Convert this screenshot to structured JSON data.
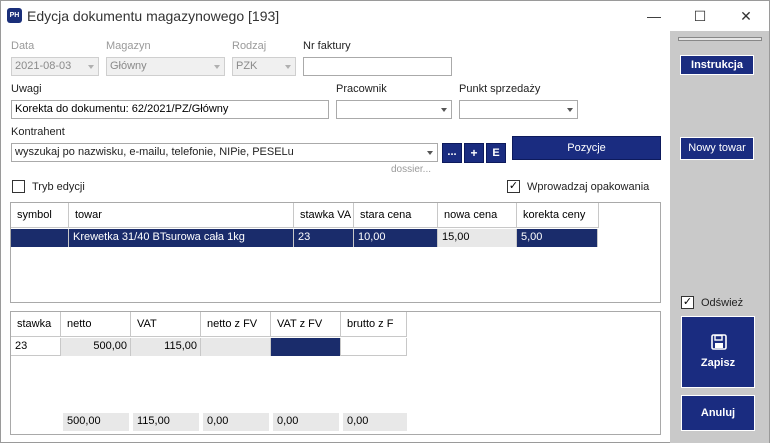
{
  "window": {
    "title": "Edycja dokumentu magazynowego [193]",
    "app_icon": "PH",
    "minimize": "—",
    "maximize": "☐",
    "close": "✕"
  },
  "form": {
    "data_label": "Data",
    "data_value": "2021-08-03",
    "magazyn_label": "Magazyn",
    "magazyn_value": "Główny",
    "rodzaj_label": "Rodzaj",
    "rodzaj_value": "PZK",
    "nr_faktury_label": "Nr faktury",
    "nr_faktury_value": "",
    "uwagi_label": "Uwagi",
    "uwagi_value": "Korekta do dokumentu: 62/2021/PZ/Główny",
    "pracownik_label": "Pracownik",
    "pracownik_value": "",
    "punkt_label": "Punkt sprzedaży",
    "punkt_value": "",
    "kontrahent_label": "Kontrahent",
    "kontrahent_placeholder": "wyszukaj po nazwisku, e-mailu, telefonie, NIPie, PESELu",
    "dossier": "dossier...",
    "btn_dots": "...",
    "btn_plus": "+",
    "btn_e": "E",
    "pozycje": "Pozycje",
    "tryb_edycji": "Tryb edycji",
    "tryb_checked": "",
    "wprowadzaj": "Wprowadzaj opakowania",
    "wprowadzaj_checked": "✓"
  },
  "items_grid": {
    "headers": [
      "symbol",
      "towar",
      "stawka VA",
      "stara cena",
      "nowa cena",
      "korekta ceny"
    ],
    "rows": [
      [
        "",
        "Krewetka 31/40 BTsurowa cała 1kg",
        "23",
        "10,00",
        "15,00",
        "5,00"
      ]
    ]
  },
  "vat_grid": {
    "headers": [
      "stawka",
      "netto",
      "VAT",
      "netto z FV",
      "VAT z FV",
      "brutto z F"
    ],
    "rows": [
      [
        "23",
        "500,00",
        "115,00",
        "",
        "",
        ""
      ]
    ],
    "totals": [
      "",
      "500,00",
      "115,00",
      "0,00",
      "0,00",
      "0,00"
    ]
  },
  "right_panel": {
    "instrukcja": "Instrukcja",
    "nowy_towar": "Nowy towar",
    "odswiez": "Odśwież",
    "odswiez_checked": "✓",
    "zapisz": "Zapisz",
    "anuluj": "Anuluj"
  },
  "colors": {
    "accent": "#1a2c80",
    "selected_row": "#1a2c6b",
    "panel": "#c9c9c9"
  }
}
